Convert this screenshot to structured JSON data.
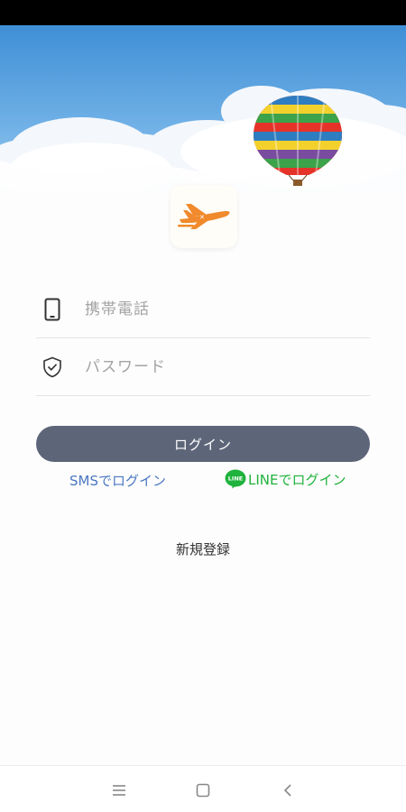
{
  "login_form": {
    "phone": {
      "icon": "smartphone-icon",
      "placeholder": "携帯電話",
      "value": ""
    },
    "password": {
      "icon": "shield-check-icon",
      "placeholder": "パスワード",
      "value": ""
    },
    "login_label": "ログイン"
  },
  "alt_login": {
    "sms_label": "SMSでログイン",
    "line_label": "LINEでログイン",
    "line_icon_text": "LINE"
  },
  "register_label": "新規登録",
  "colors": {
    "login_button": "#5d6679",
    "sms_link": "#4a78c2",
    "line_green": "#1fb23c",
    "logo_plane": "#f08a2c"
  },
  "icons": {
    "logo": "airplane-icon",
    "hero_balloon": "hot-air-balloon",
    "nav_menu": "menu-icon",
    "nav_home": "square-home-icon",
    "nav_back": "chevron-left-icon"
  }
}
